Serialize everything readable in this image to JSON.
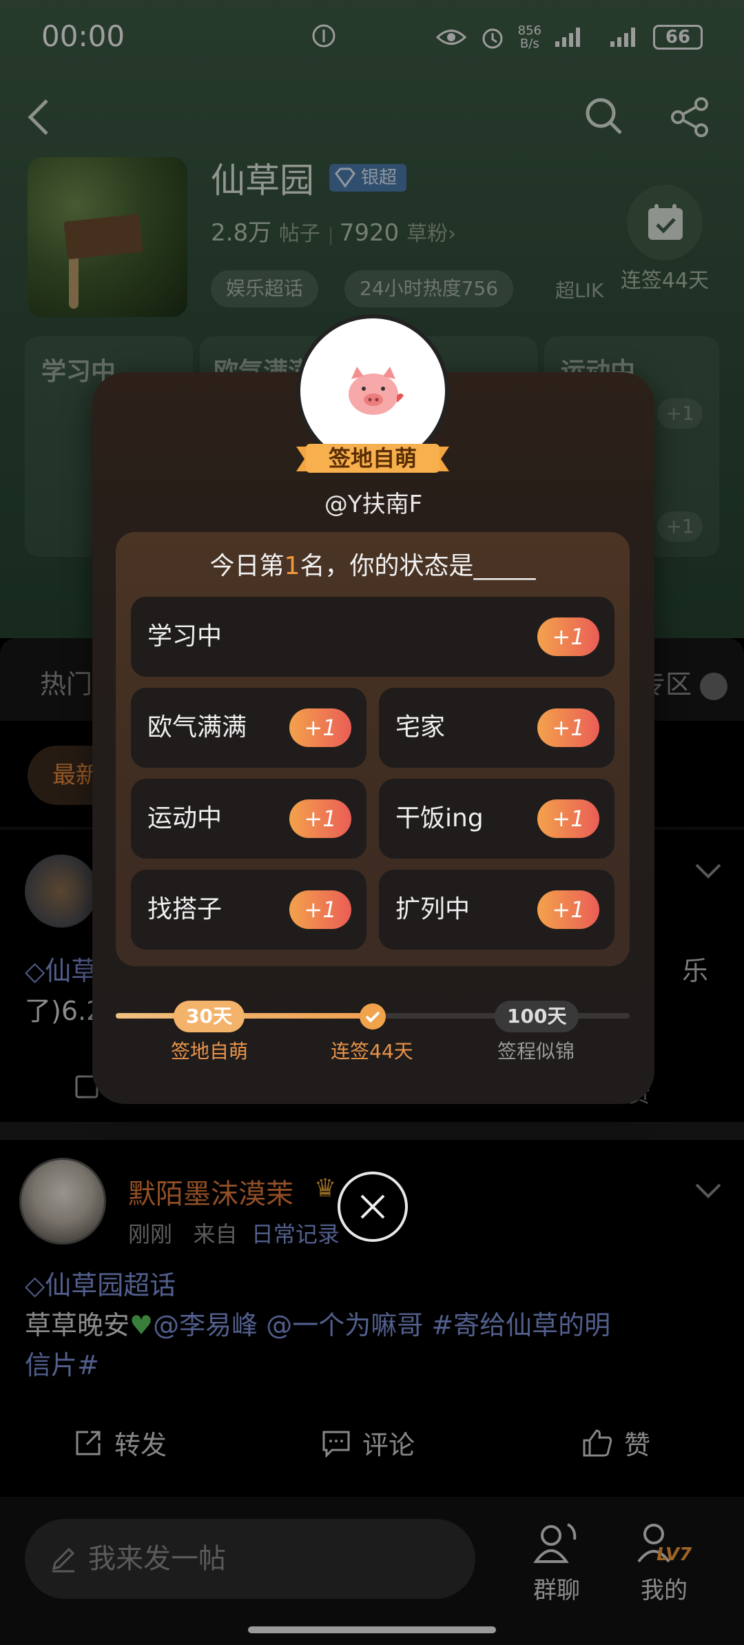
{
  "status_bar": {
    "time": "00:00",
    "net_speed_top": "856",
    "net_speed_bottom": "B/s",
    "battery": "66"
  },
  "topic": {
    "title": "仙草园",
    "badge": "银超",
    "posts_count": "2.8万",
    "posts_label": "帖子",
    "fans_count": "7920",
    "fans_label": "草粉",
    "tags": [
      "娱乐超话",
      "24小时热度756"
    ],
    "chao_label": "超LIK",
    "checkin_label": "连签44天"
  },
  "bg_cards": [
    "学习中",
    "欧气满满",
    "运动中"
  ],
  "feed": {
    "tab_hot": "热门",
    "tab_zone": "专区",
    "chip_new": "最新",
    "post1_line1": "仙草",
    "post1_line1_end": "乐",
    "post1_line2": "了)6.2",
    "post2": {
      "author": "默陌墨沫漠茉",
      "time": "刚刚",
      "from_label": "来自",
      "source": "日常记录",
      "topic_link": "仙草园超话",
      "text_a": "草草晚安",
      "mention1": "@李易峰",
      "mention2": "@一个为嘛哥",
      "hashtag_a": "#寄给仙草的明",
      "hashtag_b": "信片#"
    },
    "actions": {
      "repost": "转发",
      "comment": "评论",
      "like": "赞"
    }
  },
  "bottom": {
    "post_placeholder": "我来发一帖",
    "group_chat": "群聊",
    "mine": "我的"
  },
  "modal": {
    "ribbon": "签地自萌",
    "username": "@Y扶南F",
    "title_prefix": "今日第",
    "rank": "1",
    "title_suffix": "名，你的状态是_____",
    "options": [
      "学习中",
      "欧气满满",
      "宅家",
      "运动中",
      "干饭ing",
      "找搭子",
      "扩列中"
    ],
    "plus_label": "+1",
    "progress": {
      "fraction_filled": 0.51,
      "milestones": [
        {
          "pill": "30天",
          "label": "签地自萌",
          "done": true
        },
        {
          "pill": "",
          "label": "连签44天",
          "done": true
        },
        {
          "pill": "100天",
          "label": "签程似锦",
          "done": false
        }
      ]
    }
  },
  "colors": {
    "accent_orange": "#f29a3a",
    "link_blue": "#7f93d9",
    "author_orange": "#e07a3b"
  }
}
